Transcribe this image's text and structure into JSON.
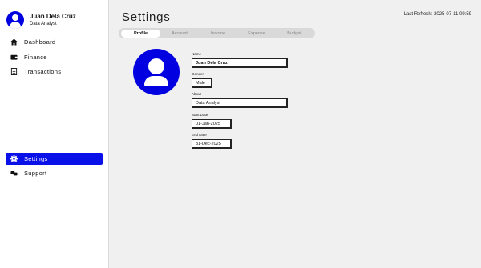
{
  "user": {
    "name": "Juan Dela Cruz",
    "role": "Data Analyst"
  },
  "nav": {
    "dashboard": "Dashboard",
    "finance": "Finance",
    "transactions": "Transactions",
    "settings": "Settings",
    "support": "Support"
  },
  "page": {
    "title": "Settings",
    "refresh": "Last Refresh: 2025-07-11 09:59"
  },
  "tabs": [
    "Profile",
    "Account",
    "Income",
    "Expense",
    "Budget"
  ],
  "active_tab": "Profile",
  "form": {
    "name_label": "Name",
    "name_value": "Juan Dela Cruz",
    "gender_label": "Gender",
    "gender_value": "Male",
    "about_label": "About",
    "about_value": "Data Analyst",
    "start_label": "Start Date",
    "start_value": "01-Jan-2025",
    "end_label": "End Date",
    "end_value": "31-Dec-2025"
  },
  "colors": {
    "accent": "#0a10e8",
    "avatar": "#0000e0",
    "sidebar": "#ffffff",
    "background": "#f0f0f0"
  },
  "icons": [
    "user-avatar-icon",
    "home-icon",
    "wallet-icon",
    "document-icon",
    "gear-icon",
    "support-icon"
  ]
}
